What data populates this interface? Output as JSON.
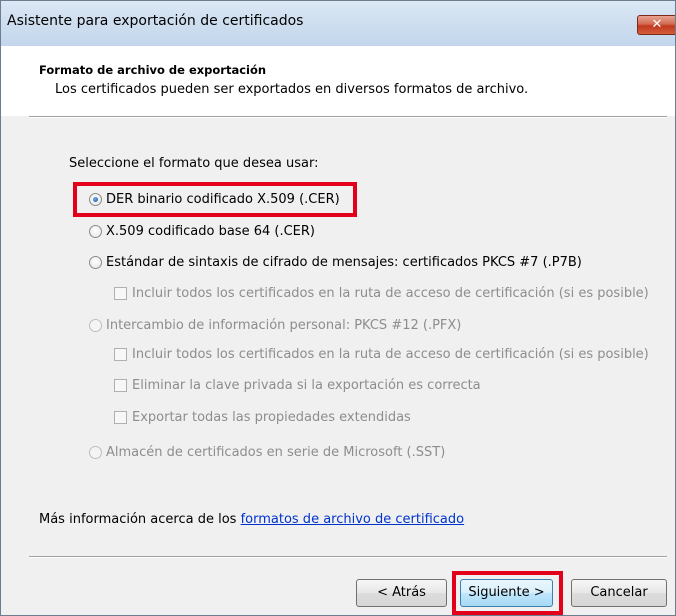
{
  "window": {
    "title": "Asistente para exportación de certificados",
    "close_glyph": "✕"
  },
  "header": {
    "title": "Formato de archivo de exportación",
    "description": "Los certificados pueden ser exportados en diversos formatos de archivo."
  },
  "body": {
    "prompt": "Seleccione el formato que desea usar:",
    "options": {
      "der": "DER binario codificado X.509 (.CER)",
      "base64": "X.509 codificado base 64 (.CER)",
      "pkcs7": "Estándar de sintaxis de cifrado de mensajes: certificados PKCS #7 (.P7B)",
      "pkcs7_include": "Incluir todos los certificados en la ruta de acceso de certificación (si es posible)",
      "pfx": "Intercambio de información personal: PKCS #12 (.PFX)",
      "pfx_include": "Incluir todos los certificados en la ruta de acceso de certificación (si es posible)",
      "pfx_delete_key": "Eliminar la clave privada si la exportación es correcta",
      "pfx_export_props": "Exportar todas las propiedades extendidas",
      "sst": "Almacén de certificados en serie de Microsoft (.SST)"
    },
    "selected_option": "der",
    "more_info_prefix": "Más información acerca de los ",
    "more_info_link": "formatos de archivo de certificado"
  },
  "buttons": {
    "back": "< Atrás",
    "next": "Siguiente >",
    "cancel": "Cancelar"
  },
  "colors": {
    "highlight": "#e3001b",
    "link": "#0033cc",
    "disabled_text": "#8d8d8d"
  }
}
